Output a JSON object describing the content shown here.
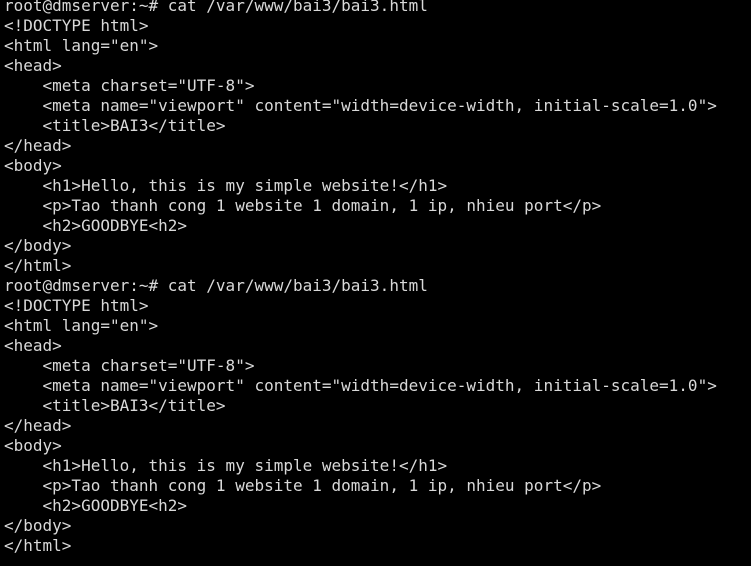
{
  "terminal": {
    "lines": [
      "root@dmserver:~# cat /var/www/bai3/bai3.html",
      "<!DOCTYPE html>",
      "<html lang=\"en\">",
      "<head>",
      "    <meta charset=\"UTF-8\">",
      "    <meta name=\"viewport\" content=\"width=device-width, initial-scale=1.0\">",
      "    <title>BAI3</title>",
      "</head>",
      "<body>",
      "    <h1>Hello, this is my simple website!</h1>",
      "    <p>Tao thanh cong 1 website 1 domain, 1 ip, nhieu port</p>",
      "    <h2>GOODBYE<h2>",
      "</body>",
      "</html>",
      "root@dmserver:~# cat /var/www/bai3/bai3.html",
      "<!DOCTYPE html>",
      "<html lang=\"en\">",
      "<head>",
      "    <meta charset=\"UTF-8\">",
      "    <meta name=\"viewport\" content=\"width=device-width, initial-scale=1.0\">",
      "    <title>BAI3</title>",
      "</head>",
      "<body>",
      "    <h1>Hello, this is my simple website!</h1>",
      "    <p>Tao thanh cong 1 website 1 domain, 1 ip, nhieu port</p>",
      "    <h2>GOODBYE<h2>",
      "</body>",
      "</html>"
    ],
    "colors": {
      "background": "#000000",
      "foreground": "#d9d9d9"
    }
  }
}
